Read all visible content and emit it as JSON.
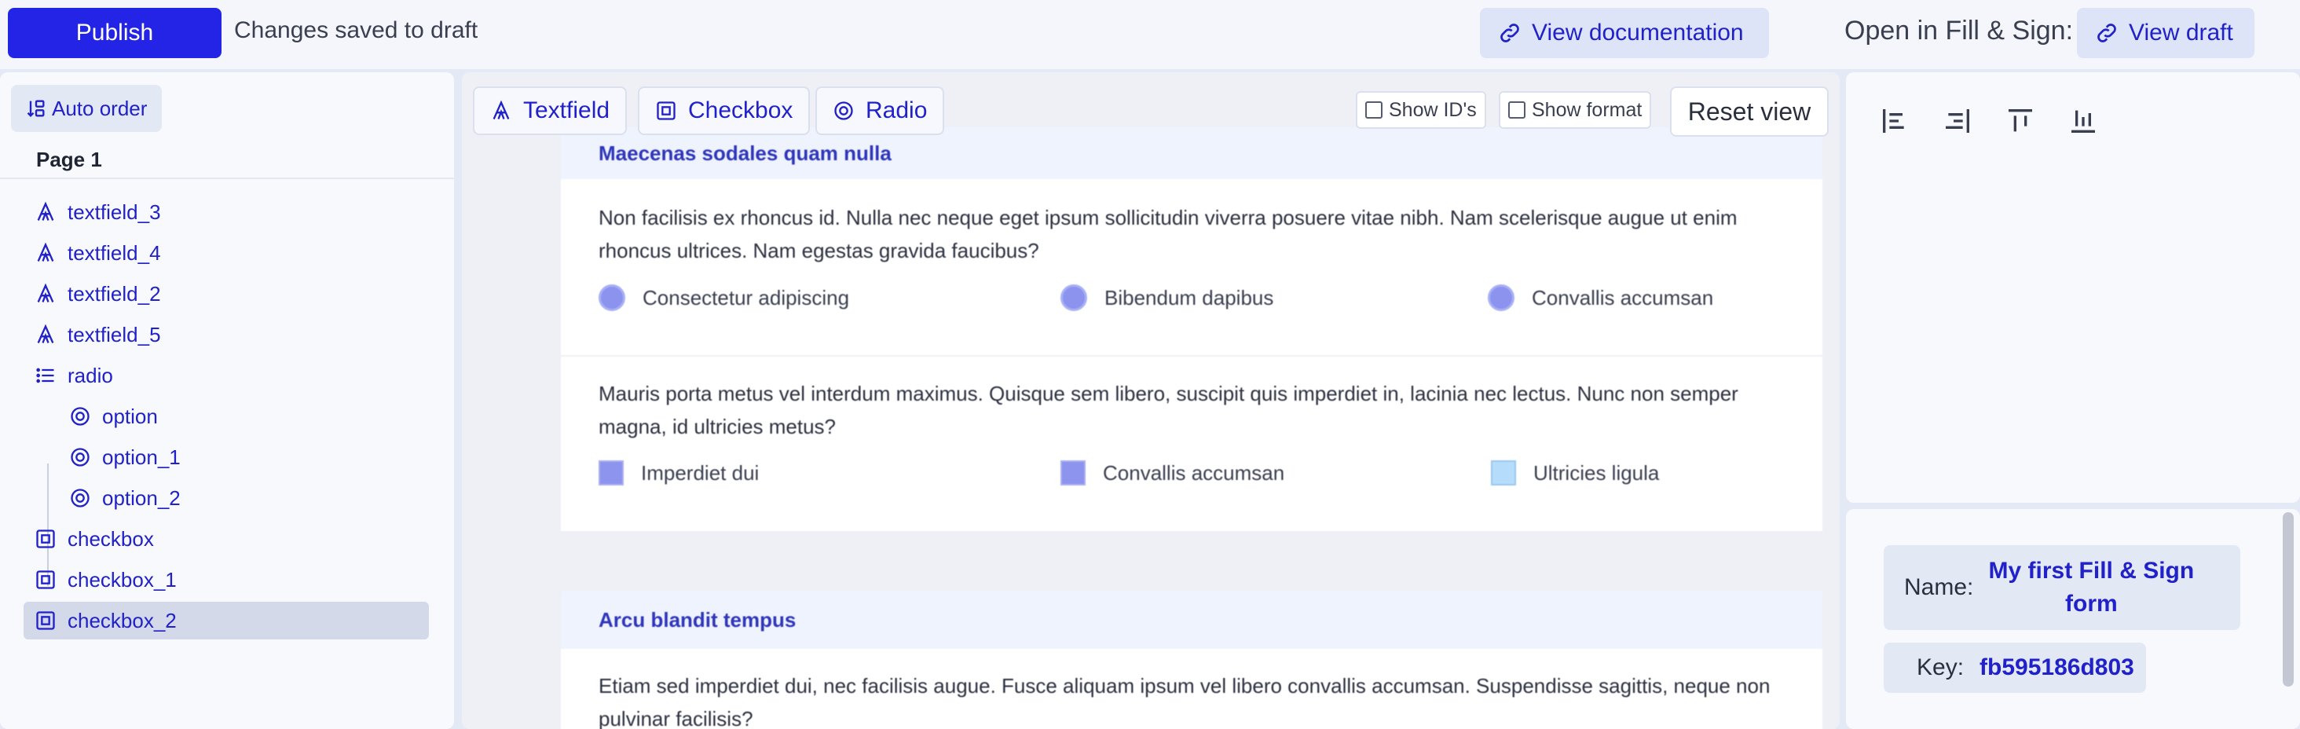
{
  "topbar": {
    "publish_label": "Publish",
    "status_text": "Changes saved to draft",
    "view_docs_label": "View documentation",
    "open_label": "Open in Fill & Sign:",
    "view_draft_label": "View draft"
  },
  "left": {
    "auto_order_label": "Auto order",
    "page_label": "Page 1",
    "items": [
      {
        "label": "textfield_3",
        "icon": "textfield-icon"
      },
      {
        "label": "textfield_4",
        "icon": "textfield-icon"
      },
      {
        "label": "textfield_2",
        "icon": "textfield-icon"
      },
      {
        "label": "textfield_5",
        "icon": "textfield-icon"
      },
      {
        "label": "radio",
        "icon": "list-icon"
      },
      {
        "label": "option",
        "icon": "radio-icon"
      },
      {
        "label": "option_1",
        "icon": "radio-icon"
      },
      {
        "label": "option_2",
        "icon": "radio-icon"
      },
      {
        "label": "checkbox",
        "icon": "checkbox-icon"
      },
      {
        "label": "checkbox_1",
        "icon": "checkbox-icon"
      },
      {
        "label": "checkbox_2",
        "icon": "checkbox-icon"
      }
    ],
    "selected_item": "checkbox_2"
  },
  "toolbar": {
    "textfield_label": "Textfield",
    "checkbox_label": "Checkbox",
    "radio_label": "Radio",
    "show_ids_label": "Show ID's",
    "show_format_label": "Show format",
    "reset_view_label": "Reset view"
  },
  "form": {
    "section1_title": "Maecenas sodales quam nulla",
    "q1_text": "Non facilisis ex rhoncus id. Nulla nec neque eget ipsum sollicitudin viverra posuere vitae nibh. Nam scelerisque augue ut enim rhoncus ultrices. Nam egestas gravida faucibus?",
    "q1_options": [
      "Consectetur adipiscing",
      "Bibendum dapibus",
      "Convallis accumsan"
    ],
    "q2_text": "Mauris porta metus vel interdum maximus. Quisque sem libero, suscipit quis imperdiet in, lacinia nec lectus. Nunc non semper magna, id ultricies metus?",
    "q2_options": [
      "Imperdiet dui",
      "Convallis accumsan",
      "Ultricies ligula"
    ],
    "section2_title": "Arcu blandit tempus",
    "q3_text": "Etiam sed imperdiet dui, nec facilisis augue. Fusce aliquam ipsum vel libero convallis accumsan. Suspendisse sagittis, neque non pulvinar facilisis?"
  },
  "right": {
    "name_label": "Name:",
    "name_value": "My first Fill & Sign form",
    "key_label": "Key:",
    "key_value": "fb595186d803"
  },
  "colors": {
    "accent": "#2424e6",
    "link": "#2121c9",
    "selected_bg": "#d3d9e9"
  }
}
